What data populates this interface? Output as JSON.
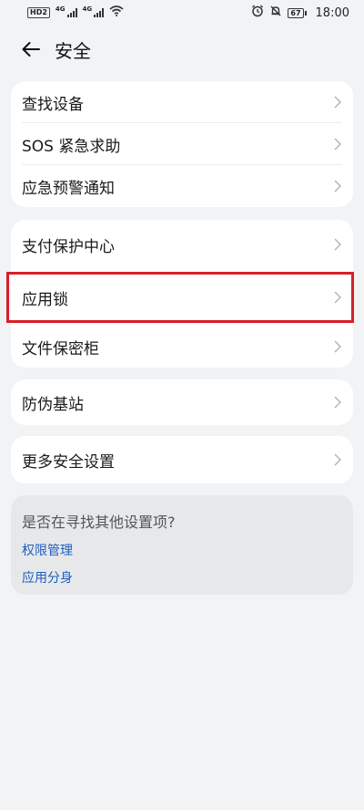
{
  "status_bar": {
    "hd_label": "HD",
    "hd_sub": "2",
    "net1": "4G",
    "net2": "4G",
    "battery": "67",
    "time": "18:00"
  },
  "header": {
    "title": "安全"
  },
  "sections": [
    {
      "items": [
        {
          "label": "查找设备"
        },
        {
          "label": "SOS 紧急求助"
        },
        {
          "label": "应急预警通知"
        }
      ]
    },
    {
      "items": [
        {
          "label": "支付保护中心"
        },
        {
          "label": "应用锁"
        },
        {
          "label": "文件保密柜"
        }
      ]
    },
    {
      "items": [
        {
          "label": "防伪基站"
        }
      ]
    },
    {
      "items": [
        {
          "label": "更多安全设置"
        }
      ]
    }
  ],
  "suggestions": {
    "title": "是否在寻找其他设置项?",
    "links": [
      {
        "label": "权限管理"
      },
      {
        "label": "应用分身"
      }
    ]
  },
  "colors": {
    "background": "#f1f3f5",
    "highlight": "#d81e2a",
    "link": "#1f5fbf"
  }
}
